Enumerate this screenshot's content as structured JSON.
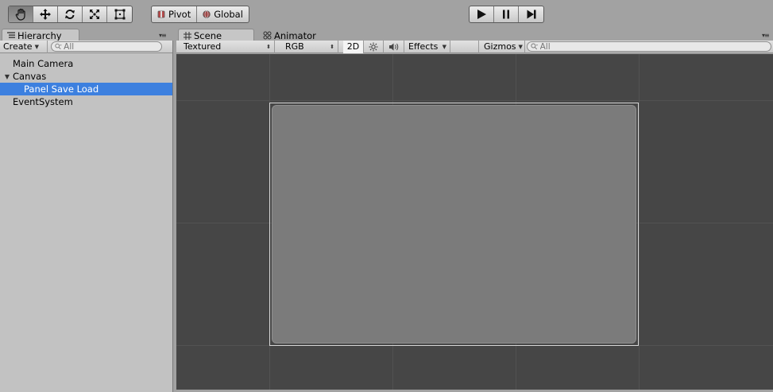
{
  "toolbar": {
    "tools": [
      {
        "name": "hand-tool",
        "icon": "hand-icon",
        "active": true
      },
      {
        "name": "move-tool",
        "icon": "move-arrows-icon",
        "active": false
      },
      {
        "name": "rotate-tool",
        "icon": "rotate-icon",
        "active": false
      },
      {
        "name": "scale-tool",
        "icon": "scale-icon",
        "active": false
      },
      {
        "name": "rect-tool",
        "icon": "rect-transform-icon",
        "active": false
      }
    ],
    "pivot_label": "Pivot",
    "global_label": "Global",
    "play": {
      "play_icon": "play-icon",
      "pause_icon": "pause-icon",
      "step_icon": "step-icon"
    }
  },
  "hierarchy": {
    "tab_label": "Hierarchy",
    "create_label": "Create",
    "search_placeholder": "All",
    "items": [
      {
        "label": "Main Camera",
        "indent": 0,
        "expandable": false,
        "selected": false
      },
      {
        "label": "Canvas",
        "indent": 0,
        "expandable": true,
        "selected": false
      },
      {
        "label": "Panel Save Load",
        "indent": 1,
        "expandable": false,
        "selected": true
      },
      {
        "label": "EventSystem",
        "indent": 0,
        "expandable": false,
        "selected": false
      }
    ]
  },
  "scene": {
    "tabs": [
      {
        "label": "Scene",
        "active": true
      },
      {
        "label": "Animator",
        "active": false
      }
    ],
    "shading_mode": "Textured",
    "color_mode": "RGB",
    "mode_2d_label": "2D",
    "effects_label": "Effects",
    "gizmos_label": "Gizmos",
    "search_placeholder": "All"
  },
  "colors": {
    "selection": "#3d80df",
    "viewport_bg": "#464646",
    "ui_panel": "#7b7b7b",
    "chrome": "#a2a2a2"
  }
}
